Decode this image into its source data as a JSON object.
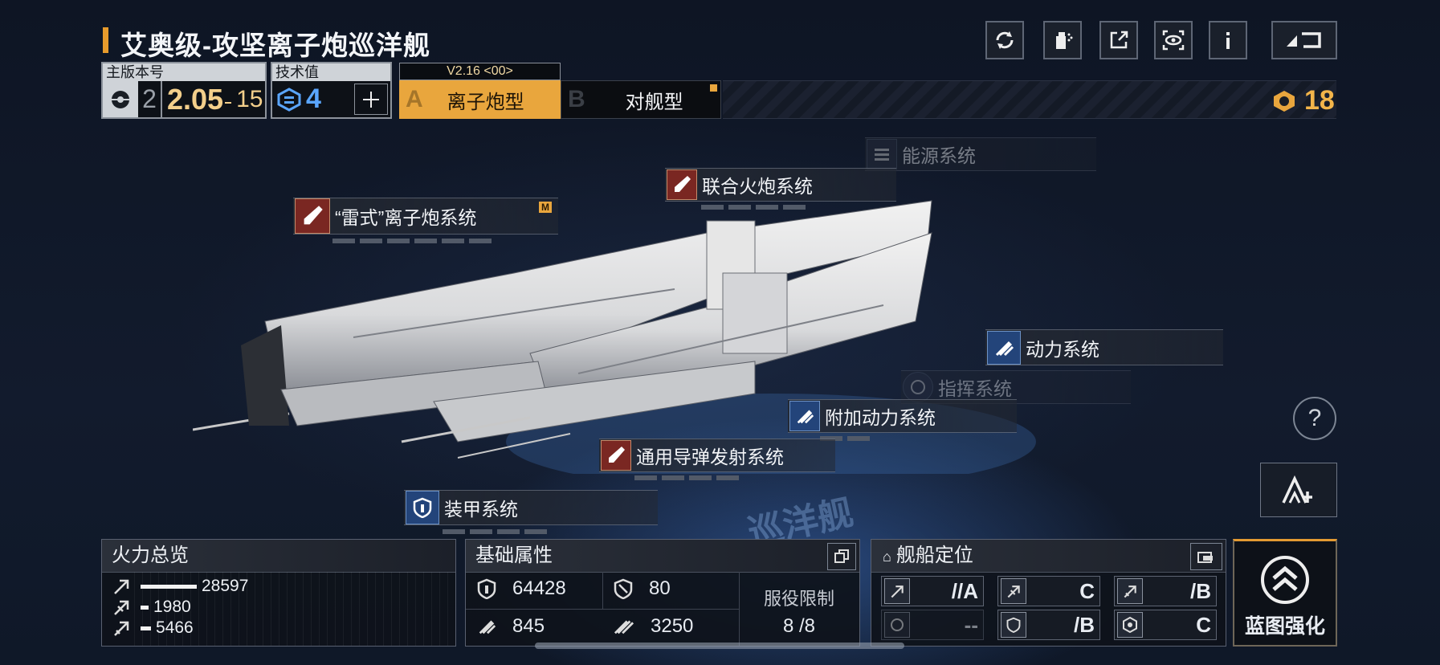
{
  "ship": {
    "title": "艾奥级-攻坚离子炮巡洋舰"
  },
  "version": {
    "label": "主版本号",
    "major": "2",
    "value": "2.05",
    "sub": "15"
  },
  "tech": {
    "label": "技术值",
    "value": "4"
  },
  "variant": {
    "version_tag": "V2.16 <00>",
    "a_letter": "A",
    "a_label": "离子炮型",
    "b_letter": "B",
    "b_label": "对舰型"
  },
  "currency": {
    "value": "18"
  },
  "systems": {
    "energy": "能源系统",
    "joint_cannon": "联合火炮系统",
    "thunder_ion": "“雷式”离子炮系统",
    "thunder_badge": "M",
    "power": "动力系统",
    "command": "指挥系统",
    "aux_power": "附加动力系统",
    "missile": "通用导弹发射系统",
    "armor": "装甲系统"
  },
  "firepower": {
    "title": "火力总览",
    "rows": [
      {
        "value": "28597",
        "ratio": 1.0
      },
      {
        "value": "1980",
        "ratio": 0.07
      },
      {
        "value": "5466",
        "ratio": 0.19
      }
    ]
  },
  "basic": {
    "title": "基础属性",
    "hp": "64428",
    "shield": "80",
    "speed": "845",
    "warp": "3250",
    "service_label": "服役限制",
    "service_value": "8 /8"
  },
  "position": {
    "title": "舰船定位",
    "roles": [
      {
        "icon": "anti-ship-icon",
        "grade": "//A"
      },
      {
        "icon": "anti-aircraft-icon",
        "grade": "C"
      },
      {
        "icon": "siege-icon",
        "grade": "/B"
      },
      {
        "icon": "support-icon",
        "grade": "--"
      },
      {
        "icon": "defense-icon",
        "grade": "/B"
      },
      {
        "icon": "utility-icon",
        "grade": "C"
      }
    ]
  },
  "upgrade": {
    "label": "蓝图强化"
  },
  "colors": {
    "accent": "#e9a63d",
    "background": "#0d1422",
    "blue": "#23447a",
    "red": "#7a2722"
  }
}
